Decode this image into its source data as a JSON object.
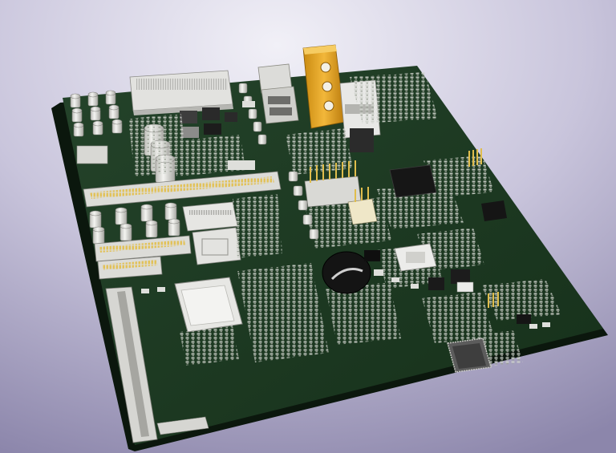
{
  "scene": {
    "subject": "pcb-motherboard-3d-render",
    "colors": {
      "background_light": "#e9e7f2",
      "background_dark": "#8a84aa",
      "board": "#1f3a22",
      "board_edge": "#0d1c0f",
      "silk": "#c9cfc4",
      "copper_gold": "#d9b44a",
      "connector_white": "#e4e4e2",
      "ic_black": "#151515",
      "heatsink_orange": "#e0a51c"
    }
  }
}
